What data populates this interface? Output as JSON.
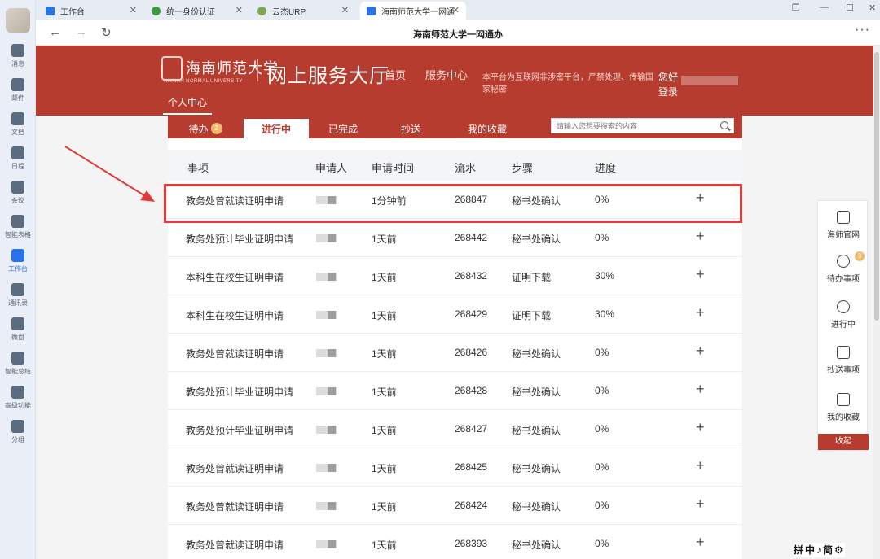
{
  "browser": {
    "tabs": [
      {
        "label": "工作台",
        "fav_color": "#2a72e8"
      },
      {
        "label": "统一身份认证",
        "fav_color": "#3c9b3c"
      },
      {
        "label": "云杰URP",
        "fav_color": "#7fa650"
      },
      {
        "label": "海南师范大学一网通",
        "fav_color": "#2a72e8"
      }
    ],
    "title": "海南师范大学一网通办"
  },
  "appbar": {
    "items": [
      {
        "label": "消息"
      },
      {
        "label": "邮件"
      },
      {
        "label": "文档"
      },
      {
        "label": "日程"
      },
      {
        "label": "会议"
      },
      {
        "label": "智能表格"
      },
      {
        "label": "工作台"
      },
      {
        "label": "通讯录"
      },
      {
        "label": "微盘"
      },
      {
        "label": "智能总结"
      },
      {
        "label": "高级功能"
      },
      {
        "label": "分组"
      }
    ]
  },
  "header": {
    "logo_cn": "海南师范大学",
    "logo_en": "HAINAN NORMAL UNIVERSITY",
    "hall": "网上服务大厅",
    "nav": [
      "首页",
      "服务中心"
    ],
    "notice": "本平台为互联网非涉密平台，严禁处理、传输国家秘密",
    "hello": "您好",
    "login": "登录",
    "personal": "个人中心"
  },
  "subtabs": {
    "todo": "待办",
    "todo_count": "2",
    "in_progress": "进行中",
    "done": "已完成",
    "cc": "抄送",
    "favorites": "我的收藏"
  },
  "search": {
    "placeholder": "请输入您想要搜索的内容"
  },
  "table": {
    "headers": [
      "事项",
      "申请人",
      "申请时间",
      "流水",
      "步骤",
      "进度"
    ],
    "rows": [
      {
        "item": "教务处曾就读证明申请",
        "time": "1分钟前",
        "serial": "268847",
        "step": "秘书处确认",
        "progress": "0%"
      },
      {
        "item": "教务处预计毕业证明申请",
        "time": "1天前",
        "serial": "268442",
        "step": "秘书处确认",
        "progress": "0%"
      },
      {
        "item": "本科生在校生证明申请",
        "time": "1天前",
        "serial": "268432",
        "step": "证明下载",
        "progress": "30%"
      },
      {
        "item": "本科生在校生证明申请",
        "time": "1天前",
        "serial": "268429",
        "step": "证明下载",
        "progress": "30%"
      },
      {
        "item": "教务处曾就读证明申请",
        "time": "1天前",
        "serial": "268426",
        "step": "秘书处确认",
        "progress": "0%"
      },
      {
        "item": "教务处预计毕业证明申请",
        "time": "1天前",
        "serial": "268428",
        "step": "秘书处确认",
        "progress": "0%"
      },
      {
        "item": "教务处预计毕业证明申请",
        "time": "1天前",
        "serial": "268427",
        "step": "秘书处确认",
        "progress": "0%"
      },
      {
        "item": "教务处曾就读证明申请",
        "time": "1天前",
        "serial": "268425",
        "step": "秘书处确认",
        "progress": "0%"
      },
      {
        "item": "教务处曾就读证明申请",
        "time": "1天前",
        "serial": "268424",
        "step": "秘书处确认",
        "progress": "0%"
      },
      {
        "item": "教务处曾就读证明申请",
        "time": "1天前",
        "serial": "268393",
        "step": "秘书处确认",
        "progress": "0%"
      }
    ]
  },
  "side_panel": {
    "items": [
      "海师官网",
      "待办事项",
      "进行中",
      "抄送事项",
      "我的收藏"
    ],
    "todo_count": "3",
    "collapse": "收起"
  },
  "ime": "拼中♪简⚙",
  "colors": {
    "brand": "#b53c2f",
    "highlight": "#e23a3a"
  }
}
